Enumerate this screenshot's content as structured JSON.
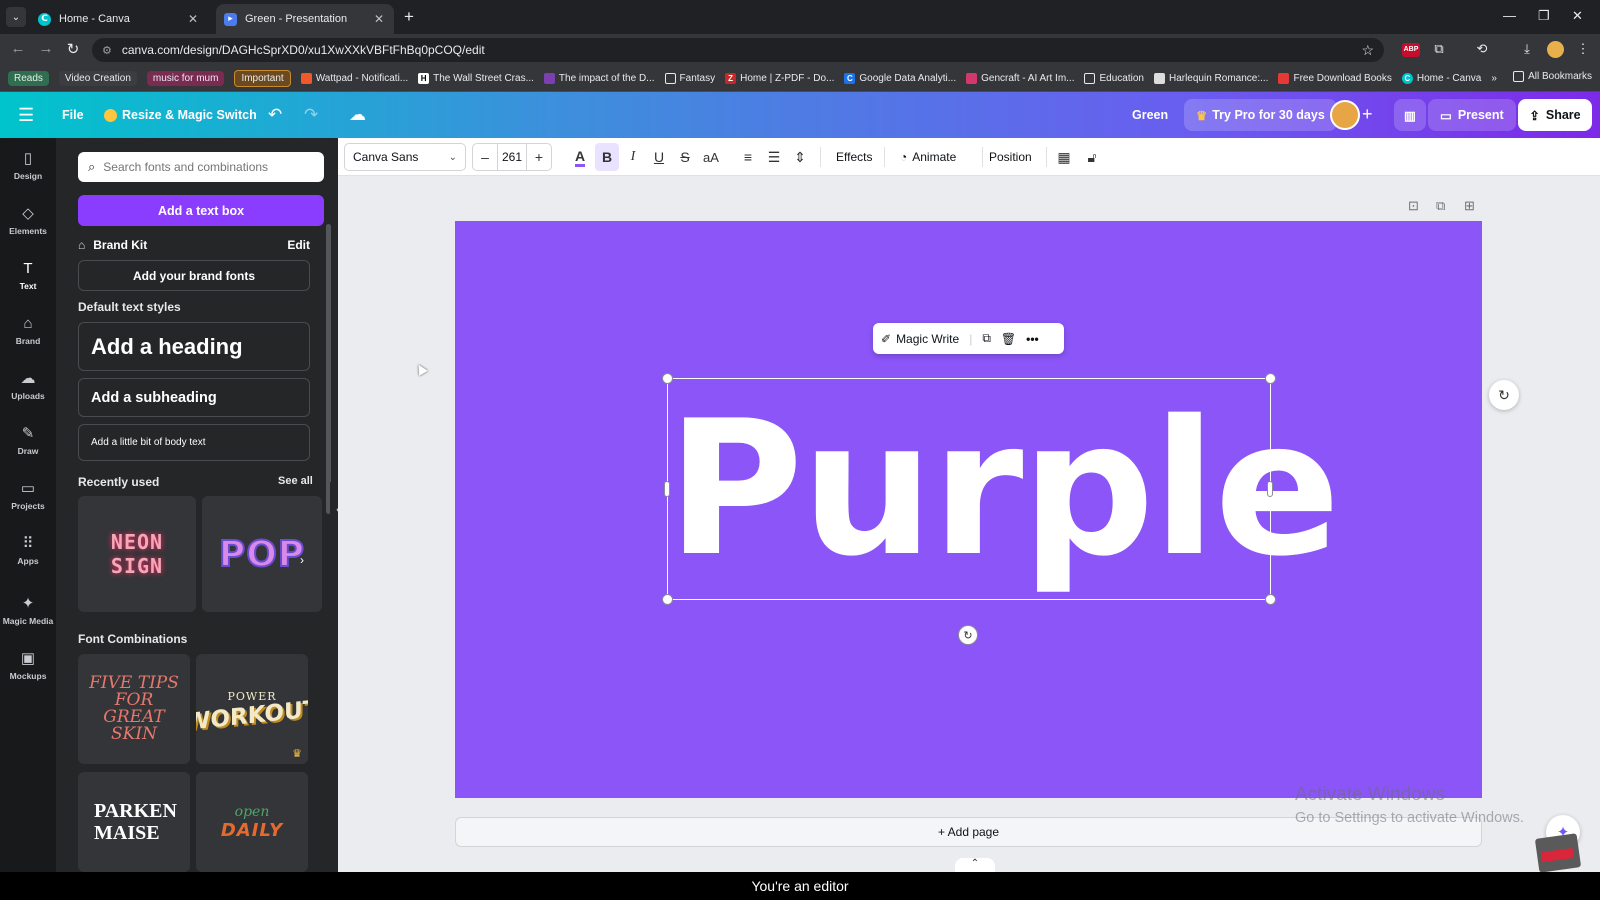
{
  "browser": {
    "tabs": [
      {
        "title": "Home - Canva",
        "active": false
      },
      {
        "title": "Green - Presentation",
        "active": true
      }
    ],
    "url": "canva.com/design/DAGHcSprXD0/xu1XwXXkVBFtFhBq0pCOQ/edit",
    "bookmarks": {
      "chips": [
        "Reads",
        "Video Creation",
        "music for mum",
        "Important"
      ],
      "items": [
        "Wattpad - Notificati...",
        "The Wall Street Cras...",
        "The impact of the D...",
        "Fantasy",
        "Home | Z-PDF - Do...",
        "Google Data Analyti...",
        "Gencraft - AI Art Im...",
        "Education",
        "Harlequin Romance:...",
        "Free Download Books",
        "Home - Canva"
      ],
      "overflow": "»",
      "all_bookmarks": "All Bookmarks"
    },
    "extensions": {
      "abp": "ABP"
    }
  },
  "header": {
    "file": "File",
    "resize": "Resize & Magic Switch",
    "design_title": "Green",
    "try_pro": "Try Pro for 30 days",
    "present": "Present",
    "share": "Share"
  },
  "rail": [
    {
      "label": "Design",
      "icon": "design-icon",
      "glyph": "▯"
    },
    {
      "label": "Elements",
      "icon": "elements-icon",
      "glyph": "◇"
    },
    {
      "label": "Text",
      "icon": "text-icon",
      "glyph": "T"
    },
    {
      "label": "Brand",
      "icon": "brand-icon",
      "glyph": "⌂"
    },
    {
      "label": "Uploads",
      "icon": "uploads-icon",
      "glyph": "☁"
    },
    {
      "label": "Draw",
      "icon": "draw-icon",
      "glyph": "✎"
    },
    {
      "label": "Projects",
      "icon": "projects-icon",
      "glyph": "▭"
    },
    {
      "label": "Apps",
      "icon": "apps-icon",
      "glyph": "⠿"
    },
    {
      "label": "Magic Media",
      "icon": "magic-media-icon",
      "glyph": "✦"
    },
    {
      "label": "Mockups",
      "icon": "mockups-icon",
      "glyph": "▣"
    }
  ],
  "panel": {
    "search_placeholder": "Search fonts and combinations",
    "add_text_box": "Add a text box",
    "brand_kit": "Brand Kit",
    "edit": "Edit",
    "add_brand_fonts": "Add your brand fonts",
    "default_styles_title": "Default text styles",
    "heading": "Add a heading",
    "subheading": "Add a subheading",
    "body": "Add a little bit of body text",
    "recently_used": "Recently used",
    "see_all": "See all",
    "neon_text": "NEON SIGN",
    "pop_text": "POP",
    "font_combinations": "Font Combinations",
    "combo1": "FIVE TIPS FOR GREAT SKIN",
    "combo2_small": "POWER",
    "combo2_big": "WORKOUT",
    "combo3": "PARKEN MAISE",
    "combo4_small": "open",
    "combo4_big": "DAILY"
  },
  "toolbar": {
    "font": "Canva Sans",
    "font_size": "261",
    "effects": "Effects",
    "animate": "Animate",
    "position": "Position"
  },
  "canvas": {
    "slide_color": "#8b55f8",
    "text": "Purple",
    "magic_write": "Magic Write",
    "add_page": "+ Add page"
  },
  "watermark": {
    "line1": "Activate Windows",
    "line2": "Go to Settings to activate Windows."
  },
  "caption": "You're an editor"
}
